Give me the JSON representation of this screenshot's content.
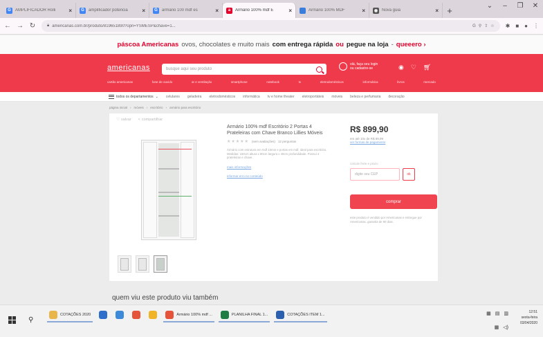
{
  "tabs": [
    {
      "title": "AMPLIFICADOR Rolli",
      "favicon": "G",
      "color": "#4285f4",
      "active": false
    },
    {
      "title": "amplificador potencia",
      "favicon": "G",
      "color": "#4285f4",
      "active": false
    },
    {
      "title": "armário 100 mdf es",
      "favicon": "G",
      "color": "#4285f4",
      "active": false
    },
    {
      "title": "Armário 100% mdf E",
      "favicon": "a",
      "color": "#e4002b",
      "active": true
    },
    {
      "title": "Armário 100% MDF",
      "favicon": "",
      "color": "#3b7ddd",
      "active": false
    },
    {
      "title": "Nova guia",
      "favicon": "◉",
      "color": "#555555",
      "active": false
    }
  ],
  "address": {
    "url": "americanas.com.br/produto/819651890?opn=YSMESP&chave=1..."
  },
  "promo": {
    "brand": "páscoa Americanas",
    "text": "ovos, chocolates e muito mais",
    "strong": "com entrega rápida",
    "mid": "ou",
    "pickup": "pegue na loja",
    "cta": "queeero ›"
  },
  "header": {
    "logo": "americanas",
    "search_placeholder": "busque aqui seu produto",
    "user_line1": "olá, faça seu login",
    "user_line2": "ou cadastre-se",
    "categories": [
      "cartão americanas",
      "fone de ouvido",
      "ar e ventilação",
      "smartphone",
      "notebook",
      "tv",
      "eletrodomésticos",
      "informática",
      "livros",
      "mercado"
    ]
  },
  "deptbar": {
    "all": "todos os departamentos",
    "items": [
      "celulares",
      "geladeira",
      "eletrodomésticos",
      "informática",
      "tv e home theater",
      "eletroportáteis",
      "móveis",
      "beleza e perfumaria",
      "decoração"
    ]
  },
  "breadcrumbs": [
    "página inicial",
    "móveis",
    "escritório",
    "armário para escritório"
  ],
  "product": {
    "share_save": "salvar",
    "share_share": "compartilhar",
    "title": "Armário 100% mdf Escritório 2 Portas 4 Prateleiras com Chave Branco Lillies Móveis",
    "rating_text": "(sem avaliações)",
    "rating_questions": "12 perguntas",
    "description": "Armário com estrutura em mdf 15mm e portas em mdf, ideal para escritório. Medidas: 160cm altura x 80cm largura x 40cm profundidade. Possui 4 prateleiras e chave.",
    "more_link": "mais informações",
    "report_link": "informar erro no conteúdo"
  },
  "buybox": {
    "price": "R$ 899,90",
    "installments": "em até 10x de R$ 89,99",
    "payment_link": "ver formas de pagamento",
    "cep_label": "calcule frete e prazo",
    "cep_placeholder": "digite seu CEP",
    "cep_button": "ok",
    "buy_button": "comprar",
    "guarantee": "este produto é vendido por Americanas e entregue por Americanas. garantia de 90 dias."
  },
  "section_title": "quem viu este produto viu também",
  "taskbar": {
    "items": [
      {
        "label": "COTAÇÕES 2020",
        "color": "#e8b64a",
        "open": true
      },
      {
        "label": "",
        "color": "#2f6fc9",
        "open": false
      },
      {
        "label": "",
        "color": "#3c8ad8",
        "open": false
      },
      {
        "label": "",
        "color": "#e5533b",
        "open": false
      },
      {
        "label": "",
        "color": "#f0b429",
        "open": false
      },
      {
        "label": "Armário 100% mdf ...",
        "color": "#e5533b",
        "open": true
      },
      {
        "label": "PLANILHA FINAL 1...",
        "color": "#1e7d45",
        "open": true
      },
      {
        "label": "COTAÇÕES ITEM 1...",
        "color": "#2b5fb0",
        "open": true
      }
    ],
    "time": "12:51",
    "day": "sexta-feira",
    "date": "03/04/2020"
  }
}
